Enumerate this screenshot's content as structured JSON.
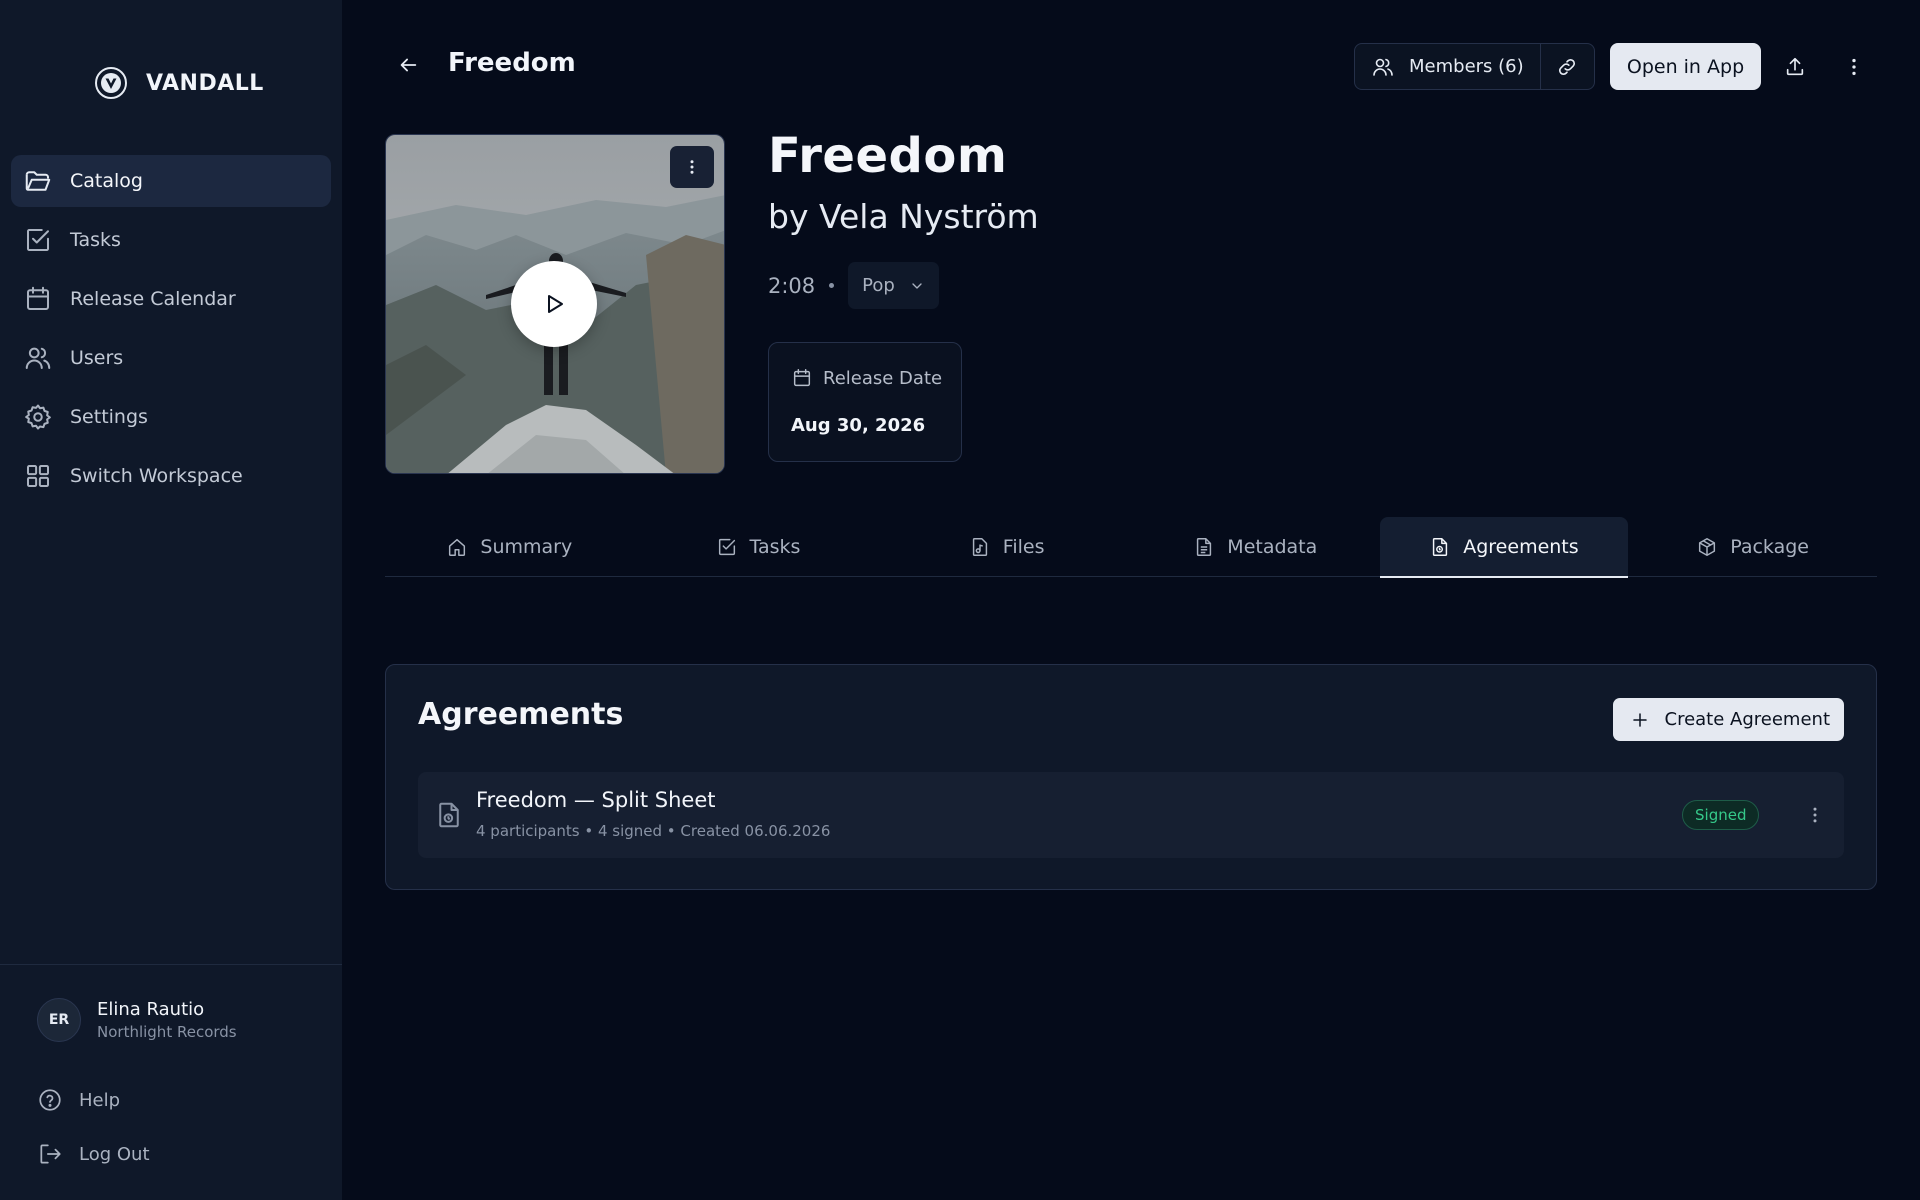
{
  "app": {
    "name": "VANDALL"
  },
  "sidebar": {
    "items": [
      {
        "label": "Catalog",
        "icon": "folder-icon",
        "active": true
      },
      {
        "label": "Tasks",
        "icon": "checkbox-icon"
      },
      {
        "label": "Release Calendar",
        "icon": "calendar-icon"
      },
      {
        "label": "Users",
        "icon": "users-icon"
      },
      {
        "label": "Settings",
        "icon": "gear-icon"
      },
      {
        "label": "Switch Workspace",
        "icon": "grid-icon"
      }
    ],
    "user": {
      "initials": "ER",
      "name": "Elina Rautio",
      "org": "Northlight Records"
    },
    "help_label": "Help",
    "logout_label": "Log Out"
  },
  "header": {
    "title": "Freedom",
    "members_label": "Members (6)",
    "open_app_label": "Open in App"
  },
  "track": {
    "title": "Freedom",
    "artist": "by Vela Nyström",
    "duration": "2:08",
    "genre": "Pop",
    "release_date_label": "Release Date",
    "release_date": "Aug 30, 2026"
  },
  "tabs": [
    {
      "label": "Summary",
      "icon": "home-icon"
    },
    {
      "label": "Tasks",
      "icon": "checkbox-icon"
    },
    {
      "label": "Files",
      "icon": "music-file-icon"
    },
    {
      "label": "Metadata",
      "icon": "document-icon"
    },
    {
      "label": "Agreements",
      "icon": "agreement-icon",
      "active": true
    },
    {
      "label": "Package",
      "icon": "package-icon"
    }
  ],
  "agreements": {
    "title": "Agreements",
    "create_label": "Create Agreement",
    "items": [
      {
        "title": "Freedom — Split Sheet",
        "subtitle": "4 participants • 4 signed • Created 06.06.2026",
        "status": "Signed"
      }
    ]
  },
  "colors": {
    "background": "#050b1a",
    "sidebar": "#0f1829",
    "accent_light": "#e5e9f1",
    "status_signed": "#35c98a"
  }
}
